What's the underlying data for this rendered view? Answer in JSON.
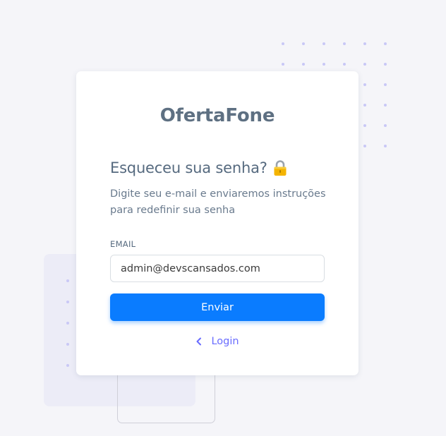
{
  "brand": {
    "name": "OfertaFone"
  },
  "form": {
    "heading": "Esqueceu sua senha?",
    "heading_icon": "lock-icon",
    "description": "Digite seu e-mail e enviaremos instruções para redefinir sua senha",
    "email_label": "EMAIL",
    "email_value": "admin@devscansados.com",
    "submit_label": "Enviar",
    "back_icon": "chevron-left-icon",
    "back_label": "Login"
  },
  "colors": {
    "primary": "#0a7cff",
    "link": "#696cff",
    "background": "#f5f5f9",
    "brand_text": "#5e7082"
  }
}
